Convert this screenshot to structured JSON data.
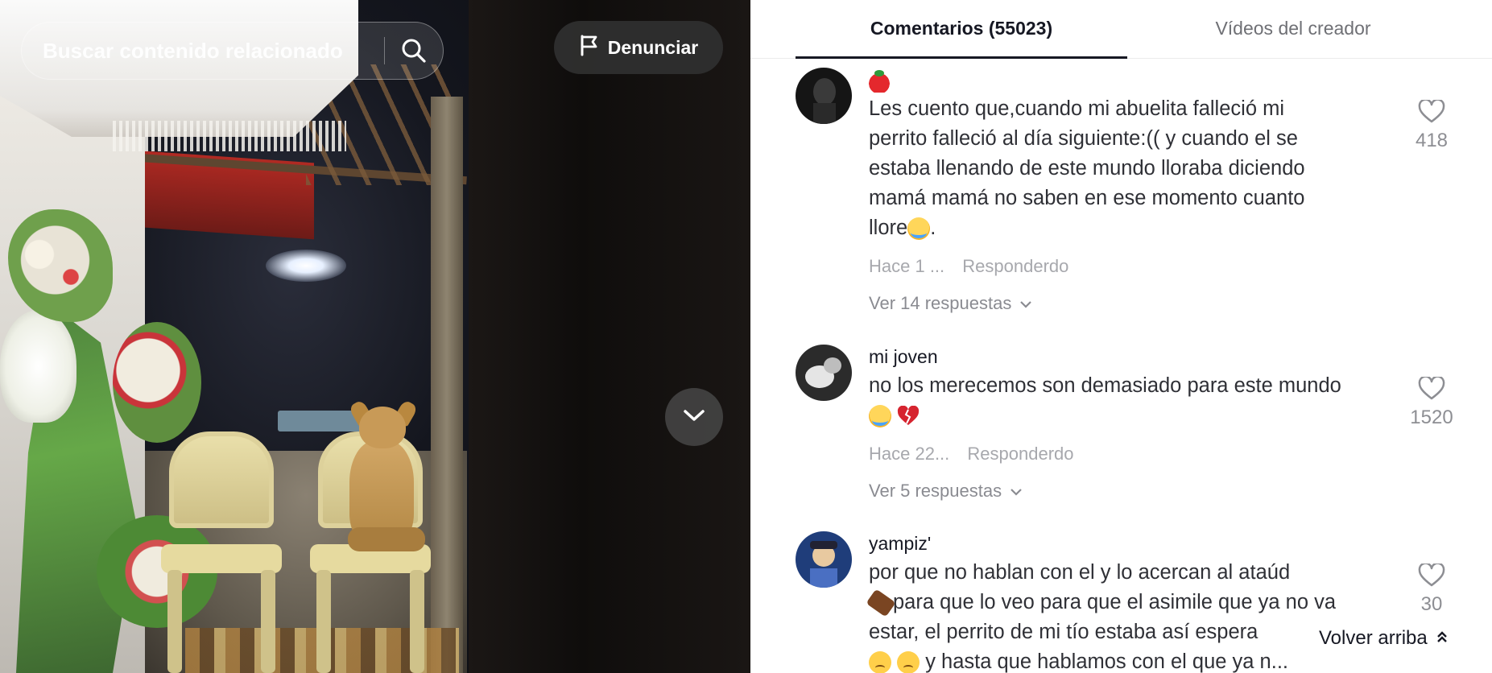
{
  "video": {
    "search_placeholder": "Buscar contenido relacionado",
    "search_icon": "search-icon",
    "report_label": "Denunciar",
    "report_icon": "flag-icon",
    "next_icon": "chevron-down-icon"
  },
  "tabs": [
    {
      "label": "Comentarios (55023)",
      "active": true
    },
    {
      "label": "Vídeos del creador",
      "active": false
    }
  ],
  "comments": [
    {
      "username": "🍓",
      "text_lines": [
        "Les cuento que,cuando mi abuelita falleció mi",
        "perrito falleció al día siguiente:(( y cuando el se",
        "estaba llenando de este mundo lloraba diciendo",
        "mamá mamá no saben en ese momento cuanto",
        "llore😭."
      ],
      "time": "Hace 1 ...",
      "reply_label": "Responder",
      "reply_suffix": "do",
      "replies_label": "Ver 14 respuestas",
      "likes": "418"
    },
    {
      "username": "mi joven",
      "text_lines": [
        "no los merecemos son demasiado para este mundo",
        "😭💔"
      ],
      "time": "Hace 22...",
      "reply_label": "Responder",
      "reply_suffix": "do",
      "replies_label": "Ver 5 respuestas",
      "likes": "1520"
    },
    {
      "username": "yampiz'",
      "text_lines": [
        "por que no hablan con el y lo acercan al ataúd",
        "⚰️para que lo veo para que el asimile que ya no va",
        "estar, el perrito de mi tío estaba así espera",
        "😔🙁 y hasta que hablamos con el que ya n..."
      ],
      "likes": "30"
    }
  ],
  "back_to_top": "Volver arriba",
  "colors": {
    "text_primary": "#161823",
    "text_secondary": "#a7a8ad",
    "tab_underline": "#161823",
    "report_bg": "#303030"
  }
}
